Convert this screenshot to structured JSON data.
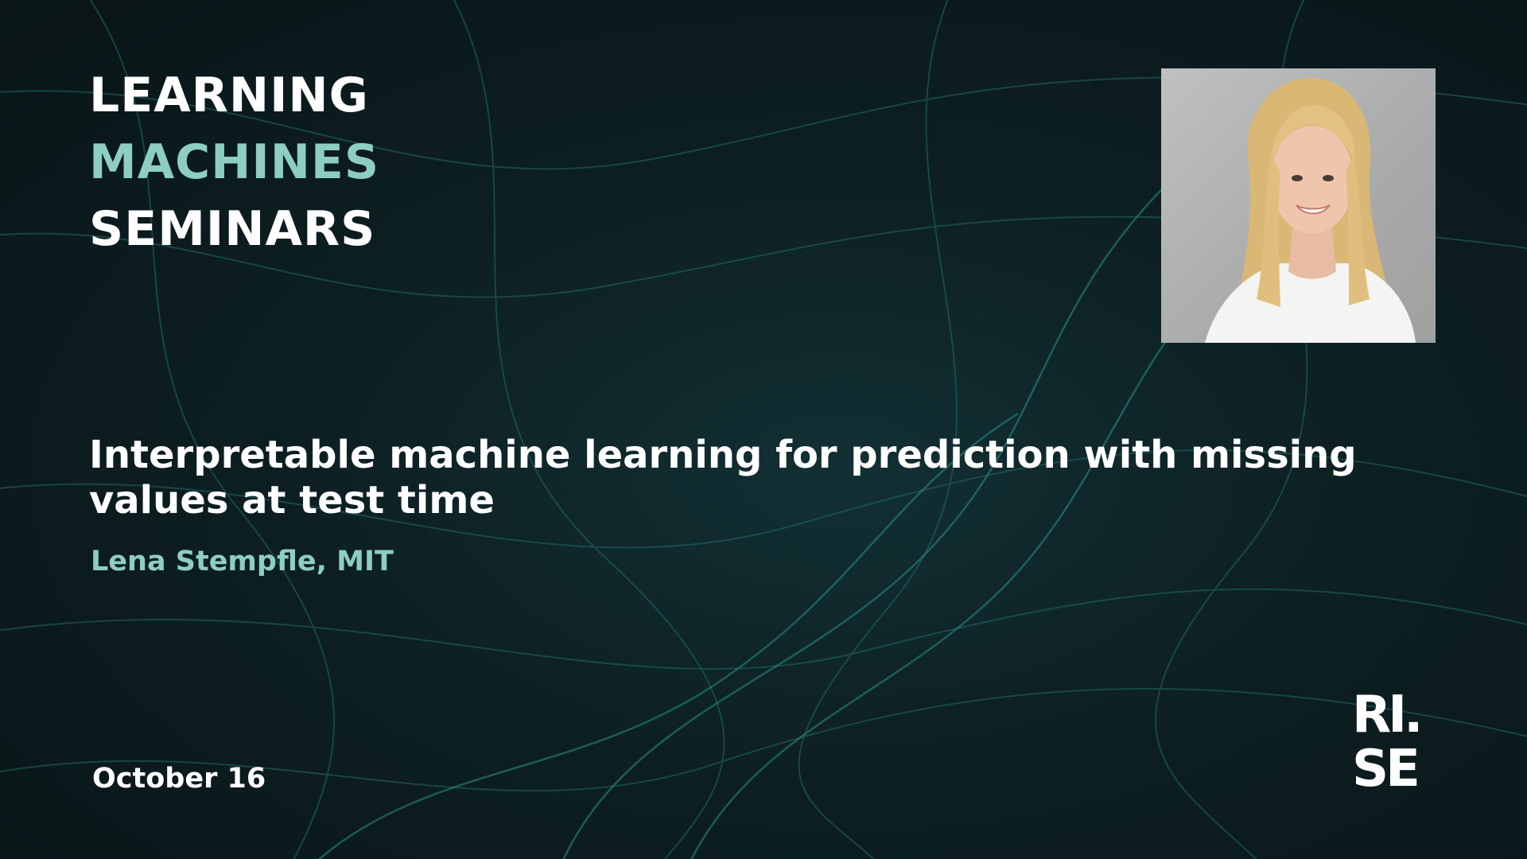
{
  "series": {
    "line1": "LEARNING",
    "line2": "MACHINES",
    "line3": "SEMINARS"
  },
  "talk": {
    "title": "Interpretable machine learning for prediction with missing values at test time",
    "speaker": "Lena Stempfle, MIT",
    "date": "October 16"
  },
  "brand": {
    "logo_text": "RI. SE",
    "logo_icon": "rise-logo-icon"
  },
  "colors": {
    "background": "#0c1a1c",
    "accent_teal": "#8ecdc4",
    "text_white": "#ffffff",
    "line_teal": "#2fa79b"
  },
  "icons": {
    "photo": "speaker-photo-icon"
  }
}
